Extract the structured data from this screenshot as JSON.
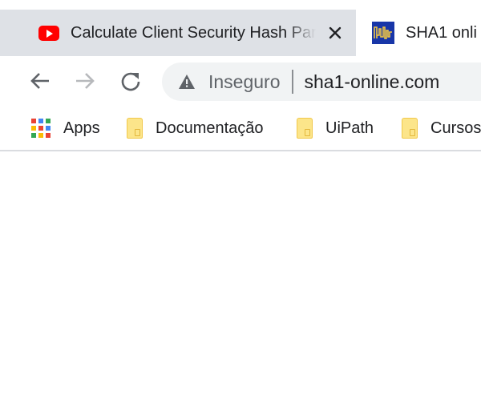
{
  "tabs": [
    {
      "title": "Calculate Client Security Hash Par",
      "icon": "youtube-icon",
      "active": true
    },
    {
      "title": "SHA1 onli",
      "icon": "sha1-online-favicon",
      "active": false
    }
  ],
  "toolbar": {
    "back_icon": "arrow-left-icon",
    "forward_icon": "arrow-right-icon",
    "reload_icon": "reload-icon"
  },
  "omnibox": {
    "security_icon": "warning-triangle-icon",
    "security_label": "Inseguro",
    "url": "sha1-online.com"
  },
  "bookmarks": [
    {
      "label": "Apps",
      "icon": "apps-grid-icon"
    },
    {
      "label": "Documentação",
      "icon": "folder-icon"
    },
    {
      "label": "UiPath",
      "icon": "folder-icon"
    },
    {
      "label": "Cursos",
      "icon": "folder-icon"
    }
  ],
  "colors": {
    "tab_strip": "#dee1e6",
    "omnibox": "#f1f3f4",
    "youtube_red": "#ff0000",
    "folder": "#fce58a"
  }
}
